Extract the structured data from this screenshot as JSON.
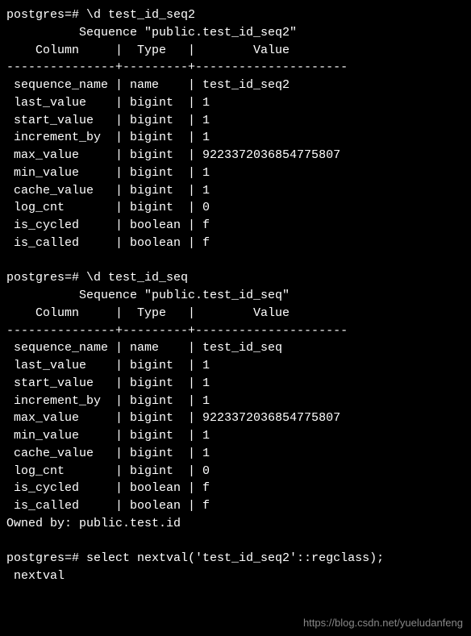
{
  "block1": {
    "prompt": "postgres=# \\d test_id_seq2",
    "title": "          Sequence \"public.test_id_seq2\"",
    "header": "    Column     |  Type   |        Value        ",
    "sep": "---------------+---------+---------------------",
    "rows": [
      " sequence_name | name    | test_id_seq2",
      " last_value    | bigint  | 1",
      " start_value   | bigint  | 1",
      " increment_by  | bigint  | 1",
      " max_value     | bigint  | 9223372036854775807",
      " min_value     | bigint  | 1",
      " cache_value   | bigint  | 1",
      " log_cnt       | bigint  | 0",
      " is_cycled     | boolean | f",
      " is_called     | boolean | f"
    ]
  },
  "block2": {
    "prompt": "postgres=# \\d test_id_seq",
    "title": "          Sequence \"public.test_id_seq\"",
    "header": "    Column     |  Type   |        Value        ",
    "sep": "---------------+---------+---------------------",
    "rows": [
      " sequence_name | name    | test_id_seq",
      " last_value    | bigint  | 1",
      " start_value   | bigint  | 1",
      " increment_by  | bigint  | 1",
      " max_value     | bigint  | 9223372036854775807",
      " min_value     | bigint  | 1",
      " cache_value   | bigint  | 1",
      " log_cnt       | bigint  | 0",
      " is_cycled     | boolean | f",
      " is_called     | boolean | f"
    ],
    "owned": "Owned by: public.test.id"
  },
  "query": {
    "prompt": "postgres=# select nextval('test_id_seq2'::regclass);",
    "header": " nextval"
  },
  "watermark": "https://blog.csdn.net/yueludanfeng"
}
